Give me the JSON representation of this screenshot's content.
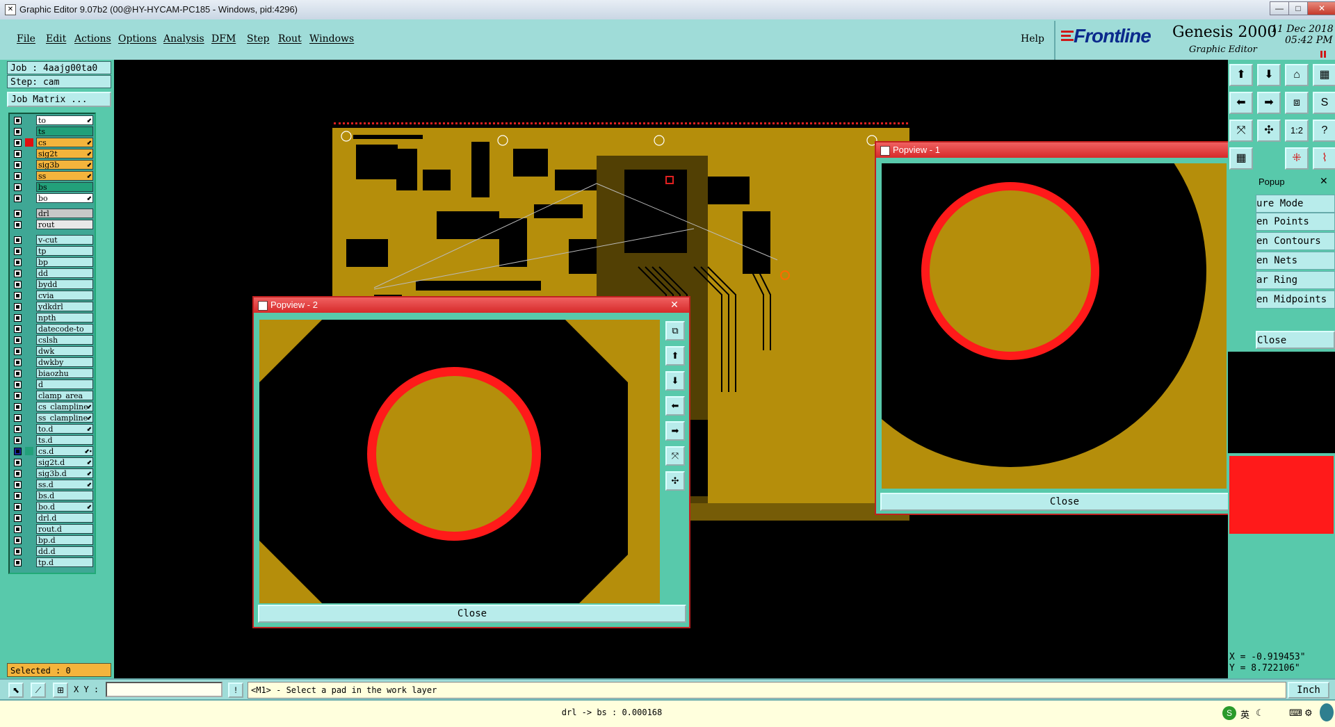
{
  "window": {
    "title": "Graphic Editor 9.07b2 (00@HY-HYCAM-PC185 - Windows, pid:4296)",
    "minimize": "—",
    "maximize": "□",
    "close": "✕"
  },
  "menu": [
    "File",
    "Edit",
    "Actions",
    "Options",
    "Analysis",
    "DFM",
    "Step",
    "Rout",
    "Windows"
  ],
  "help": "Help",
  "brand": {
    "logo": "Frontline",
    "product": "Genesis 2000",
    "subtitle": "Graphic Editor",
    "date": "11 Dec 2018",
    "time": "05:42 PM"
  },
  "job": {
    "job_label": "Job : 4aajg00ta0",
    "step_label": "Step: cam",
    "matrix_button": "Job Matrix ..."
  },
  "colors": {
    "board": "#b58e0b",
    "pad_ring": "#ff1a1a",
    "panel": "#58c9ab",
    "field": "#b8eceb",
    "menubar": "#9fdcd8"
  },
  "layers_group1": [
    {
      "name": "to",
      "color": "#ffffff",
      "swatch": "",
      "edit": true
    },
    {
      "name": "ts",
      "color": "#22a07a",
      "swatch": "",
      "edit": false
    },
    {
      "name": "cs",
      "color": "#f4b43c",
      "swatch": "#e01010",
      "edit": true
    },
    {
      "name": "sig2t",
      "color": "#f4b43c",
      "swatch": "",
      "edit": true
    },
    {
      "name": "sig3b",
      "color": "#f4b43c",
      "swatch": "",
      "edit": true
    },
    {
      "name": "ss",
      "color": "#f4b43c",
      "swatch": "",
      "edit": true
    },
    {
      "name": "bs",
      "color": "#22a07a",
      "swatch": "",
      "edit": false
    },
    {
      "name": "bo",
      "color": "#ffffff",
      "swatch": "",
      "edit": true
    }
  ],
  "layers_group2": [
    {
      "name": "drl",
      "color": "#c8c8c8",
      "swatch": "",
      "edit": false
    },
    {
      "name": "rout",
      "color": "#e8e8e8",
      "swatch": "",
      "edit": false
    }
  ],
  "layers_group3": [
    {
      "name": "v-cut",
      "edit": false
    },
    {
      "name": "tp",
      "edit": false
    },
    {
      "name": "bp",
      "edit": false
    },
    {
      "name": "dd",
      "edit": false
    },
    {
      "name": "bydd",
      "edit": false
    },
    {
      "name": "cvia",
      "edit": false
    },
    {
      "name": "ydkdrl",
      "edit": false
    },
    {
      "name": "npth",
      "edit": false
    },
    {
      "name": "datecode-to",
      "edit": false
    },
    {
      "name": "cslsh",
      "edit": false
    },
    {
      "name": "dwk",
      "edit": false
    },
    {
      "name": "dwkby",
      "edit": false
    },
    {
      "name": "biaozhu",
      "edit": false
    },
    {
      "name": "d",
      "edit": false
    },
    {
      "name": "clamp_area",
      "edit": false
    },
    {
      "name": "cs_clampline",
      "edit": true
    },
    {
      "name": "ss_clampline",
      "edit": true
    },
    {
      "name": "to.d",
      "edit": true
    },
    {
      "name": "ts.d",
      "edit": false
    },
    {
      "name": "cs.d",
      "edit": true,
      "active": true
    },
    {
      "name": "sig2t.d",
      "edit": true
    },
    {
      "name": "sig3b.d",
      "edit": true
    },
    {
      "name": "ss.d",
      "edit": true
    },
    {
      "name": "bs.d",
      "edit": false
    },
    {
      "name": "bo.d",
      "edit": true
    },
    {
      "name": "drl.d",
      "edit": false
    },
    {
      "name": "rout.d",
      "edit": false
    },
    {
      "name": "bp.d",
      "edit": false
    },
    {
      "name": "dd.d",
      "edit": false
    },
    {
      "name": "tp.d",
      "edit": false
    }
  ],
  "selected": "Selected : 0",
  "popview1": {
    "title": "Popview - 1",
    "close": "Close"
  },
  "popview2": {
    "title": "Popview - 2",
    "close": "Close"
  },
  "popup_menu": {
    "title": "Popup",
    "items": [
      "ure Mode",
      "en Points",
      "en Contours",
      "en Nets",
      "ar Ring",
      "en Midpoints"
    ],
    "close": "Close"
  },
  "coords": {
    "x": "X = -0.919453\"",
    "y": "Y = 8.722106\""
  },
  "cmd": {
    "xy_label": "X Y :",
    "xy_value": "",
    "prompt": "<M1> - Select a pad in the work layer",
    "units": "Inch"
  },
  "status": {
    "text": "drl -> bs : 0.000168",
    "ime": "英"
  }
}
